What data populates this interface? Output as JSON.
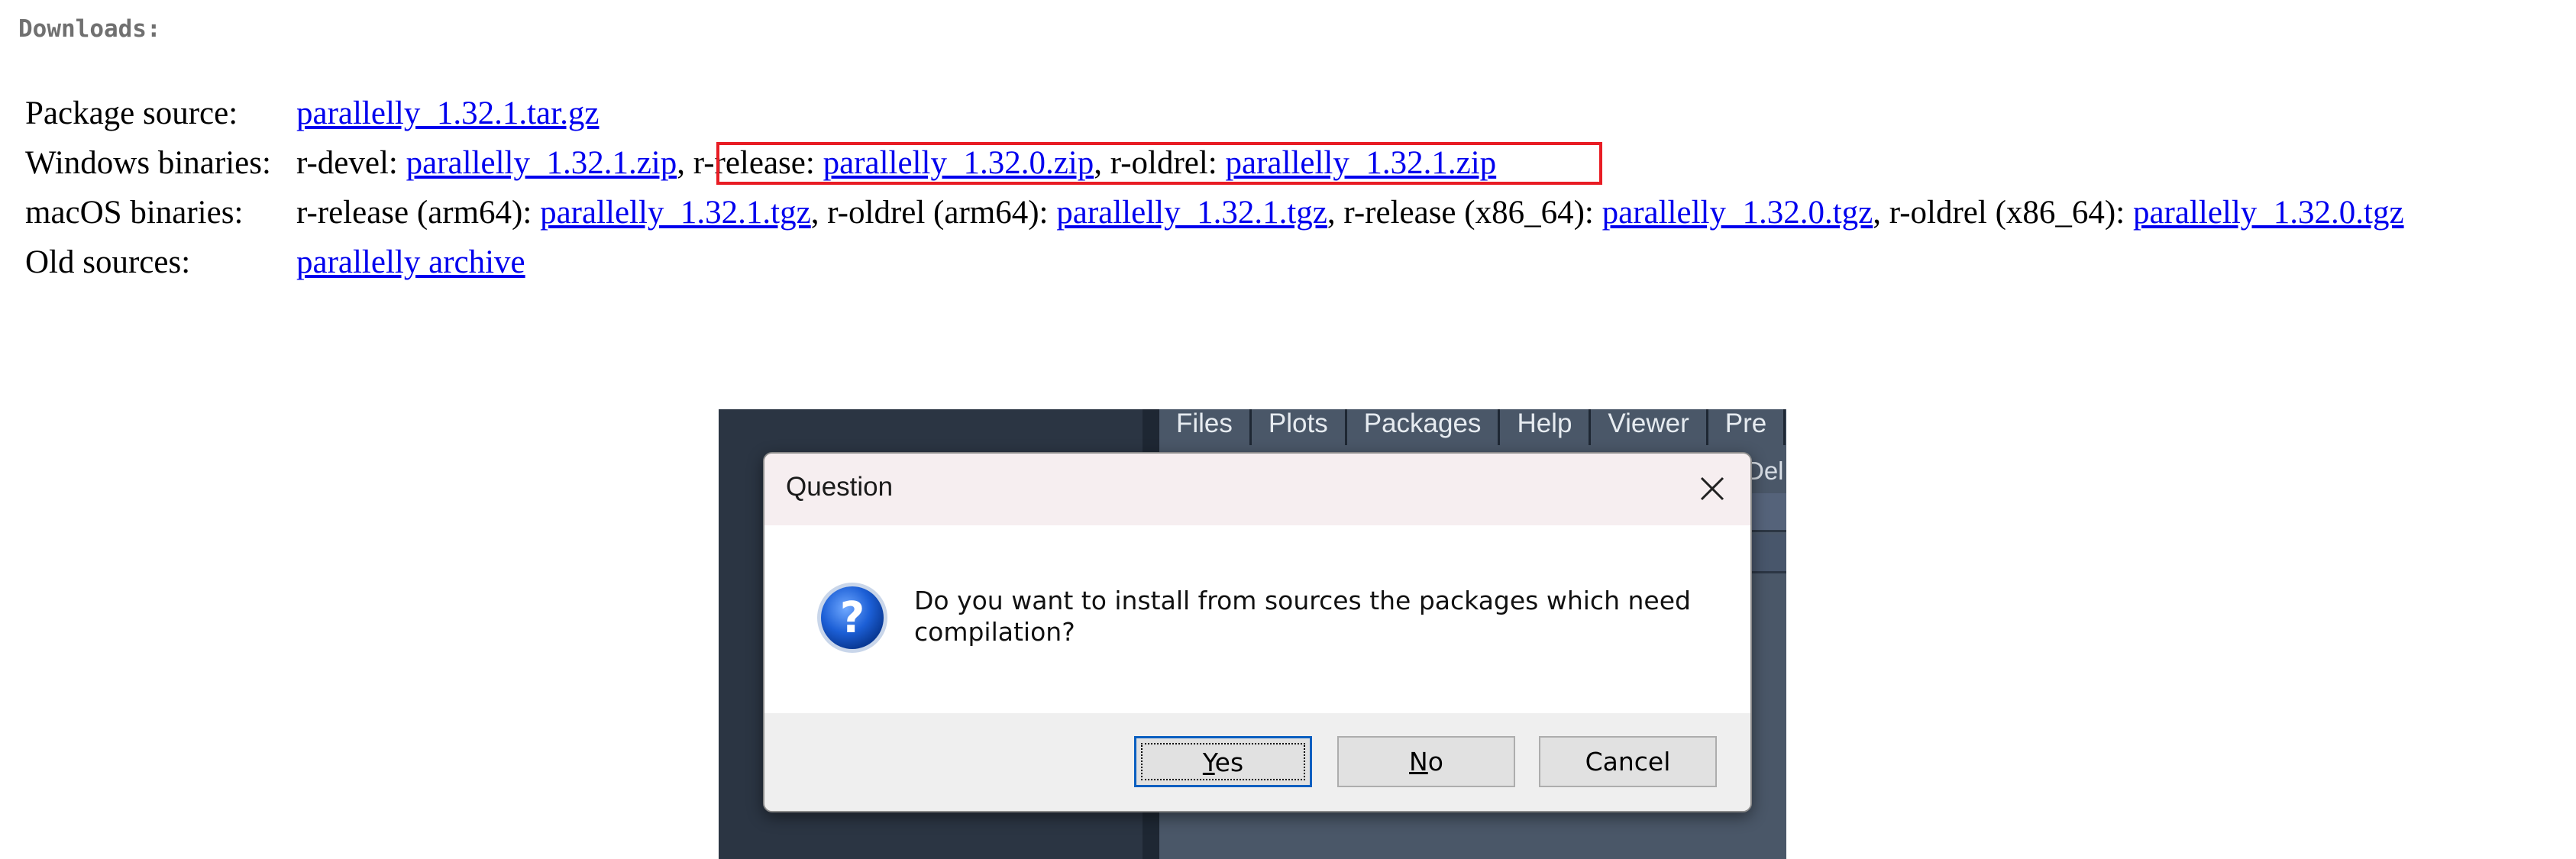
{
  "downloads": {
    "heading": "Downloads:",
    "package_source": {
      "label": "Package source:",
      "link": "parallelly_1.32.1.tar.gz"
    },
    "windows": {
      "label": "Windows binaries:",
      "devel_prefix": "r-devel: ",
      "devel_link": "parallelly_1.32.1.zip",
      "sep1": ", ",
      "release_prefix": "r-release: ",
      "release_link": "parallelly_1.32.0.zip",
      "sep2": ", r-oldrel: ",
      "oldrel_link": "parallelly_1.32.1.zip"
    },
    "macos": {
      "label": "macOS binaries:",
      "p1": "r-release (arm64): ",
      "l1": "parallelly_1.32.1.tgz",
      "p2": ", r-oldrel (arm64): ",
      "l2": "parallelly_1.32.1.tgz",
      "p3": ", r-release (x86_64): ",
      "l3": "parallelly_1.32.0.tgz",
      "p4": ", r-oldrel (x86_64): ",
      "l4": "parallelly_1.32.0.tgz"
    },
    "old_sources": {
      "label": "Old sources:",
      "link": "parallelly archive"
    },
    "highlight_color": "#e81c24"
  },
  "rstudio": {
    "tabs": [
      "Files",
      "Plots",
      "Packages",
      "Help",
      "Viewer",
      "Pre"
    ],
    "fragment": "Del"
  },
  "dialog": {
    "title": "Question",
    "close_icon": "close-icon",
    "question_icon": "question-icon",
    "message": "Do you want to install from sources the packages which need compilation?",
    "buttons": {
      "yes_mnemonic": "Y",
      "yes_rest": "es",
      "no_mnemonic": "N",
      "no_rest": "o",
      "cancel": "Cancel"
    }
  }
}
